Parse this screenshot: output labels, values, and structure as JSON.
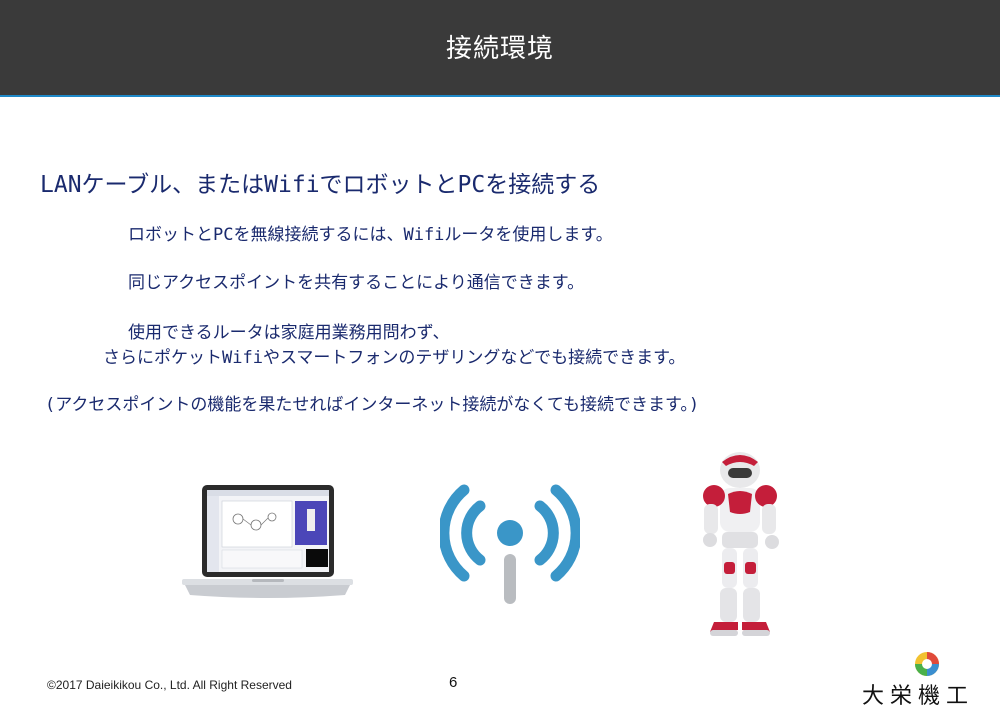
{
  "header": {
    "title": "接続環境"
  },
  "content": {
    "heading": "LANケーブル、またはWifiでロボットとPCを接続する",
    "line1": "ロボットとPCを無線接続するには、Wifiルータを使用します。",
    "line2": "同じアクセスポイントを共有することにより通信できます。",
    "line3a": "使用できるルータは家庭用業務用問わず、",
    "line3b": "さらにポケットWifiやスマートフォンのテザリングなどでも接続できます。",
    "line4": "(アクセスポイントの機能を果たせればインターネット接続がなくても接続できます。)"
  },
  "images": {
    "laptop": "laptop-icon",
    "wifi": "wifi-icon",
    "robot": "robot-image"
  },
  "footer": {
    "copyright": "©2017 Daieikikou Co., Ltd. All Right Reserved",
    "page_number": "6",
    "logo_text": "大栄機工"
  },
  "colors": {
    "header_bg": "#3a3a3a",
    "header_border": "#1e88c7",
    "text": "#1a2a6e",
    "wifi_blue": "#3a96c8"
  }
}
